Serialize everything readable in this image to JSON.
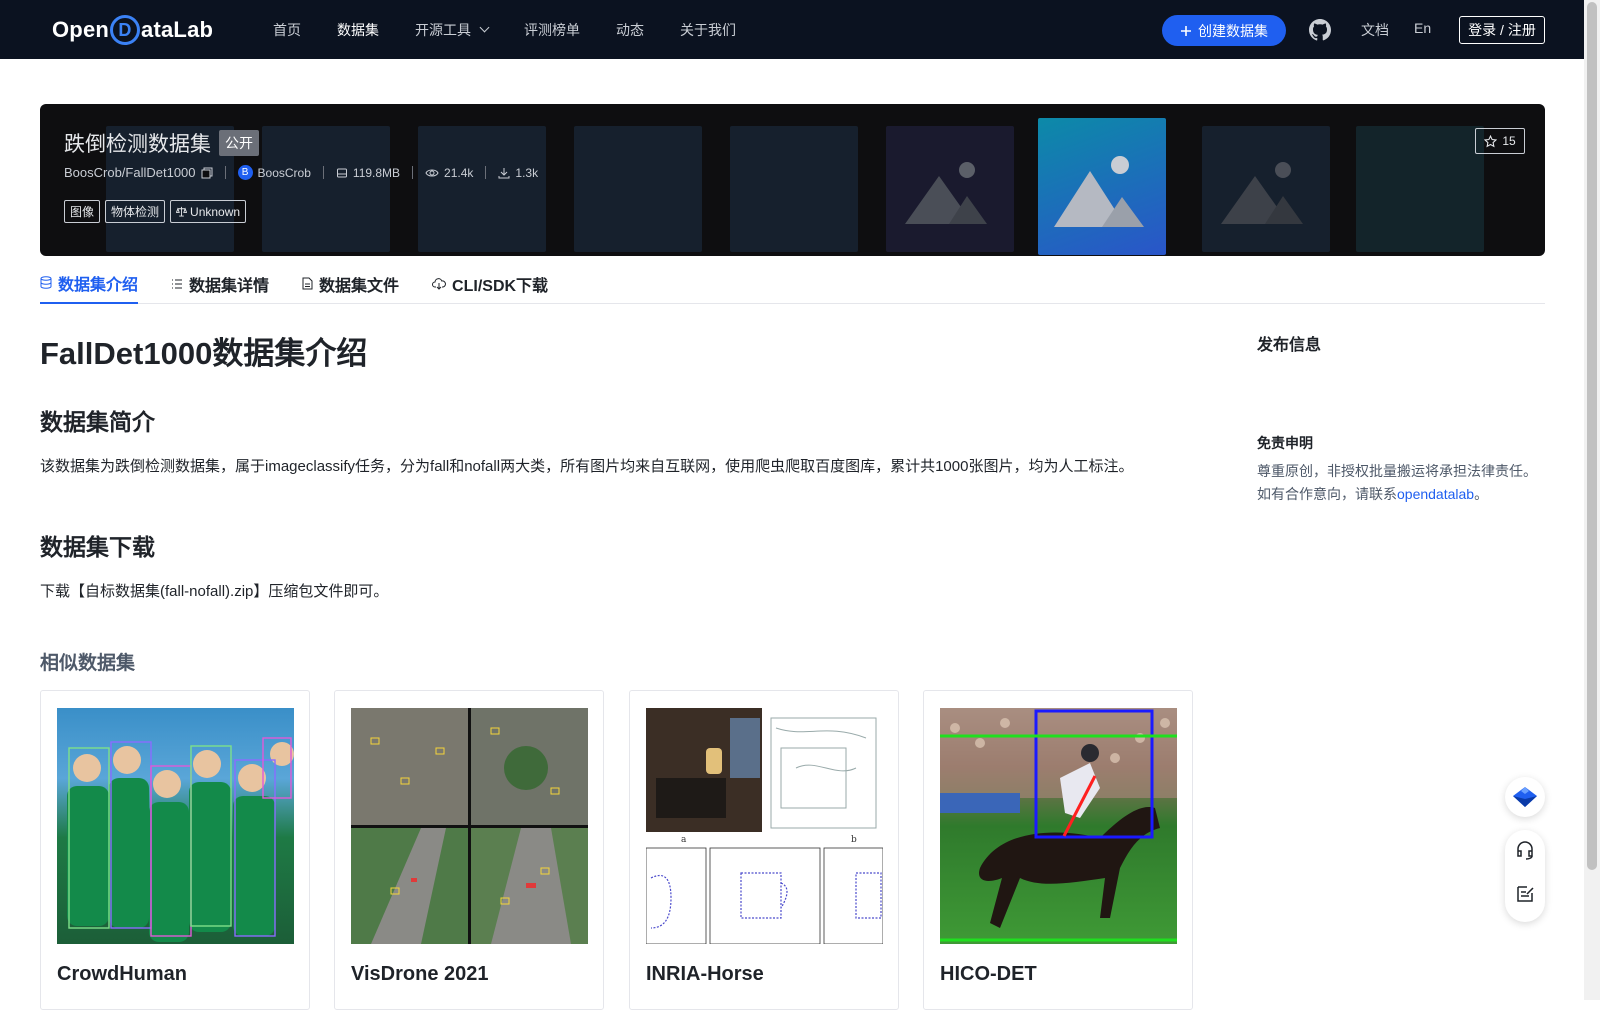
{
  "nav": {
    "logo": {
      "prefix": "Open",
      "d": "D",
      "suffix": "ataLab"
    },
    "links": [
      "首页",
      "数据集",
      "开源工具",
      "评测榜单",
      "动态",
      "关于我们"
    ],
    "create_label": "创建数据集",
    "docs_label": "文档",
    "lang_label": "En",
    "login_label": "登录 / 注册"
  },
  "hero": {
    "title": "跌倒检测数据集",
    "public_badge": "公开",
    "repo": "BoosCrob/FallDet1000",
    "author_initial": "B",
    "author": "BoosCrob",
    "size": "119.8MB",
    "views": "21.4k",
    "downloads": "1.3k",
    "tags": [
      "图像",
      "物体检测",
      "Unknown"
    ],
    "stars": "15"
  },
  "tabs": [
    "数据集介绍",
    "数据集详情",
    "数据集文件",
    "CLI/SDK下载"
  ],
  "content": {
    "h1": "FallDet1000数据集介绍",
    "intro_h": "数据集简介",
    "intro_p": "该数据集为跌倒检测数据集，属于imageclassify任务，分为fall和nofall两大类，所有图片均来自互联网，使用爬虫爬取百度图库，累计共1000张图片，均为人工标注。",
    "download_h": "数据集下载",
    "download_p": "下载【自标数据集(fall-nofall).zip】压缩包文件即可。",
    "similar_h": "相似数据集",
    "similar": [
      "CrowdHuman",
      "VisDrone 2021",
      "INRIA-Horse",
      "HICO-DET"
    ],
    "inria_labels": [
      "a",
      "b"
    ]
  },
  "sidebar": {
    "publish_title": "发布信息",
    "disclaimer_title": "免责申明",
    "disclaimer_line1": "尊重原创，非授权批量搬运将承担法律责任。",
    "disclaimer_line2_prefix": "如有合作意向，请联系",
    "disclaimer_link": "opendatalab",
    "disclaimer_line2_suffix": "。"
  },
  "colors": {
    "brand": "#1f5ff0",
    "nav_bg": "#0b1220"
  },
  "icons": [
    "plus-icon",
    "github-icon",
    "copy-icon",
    "database-icon",
    "eye-icon",
    "download-icon",
    "scale-icon",
    "star-icon",
    "list-icon",
    "file-icon",
    "cloud-icon",
    "image-placeholder-icon",
    "feedback-icon",
    "headset-icon",
    "edit-icon"
  ]
}
